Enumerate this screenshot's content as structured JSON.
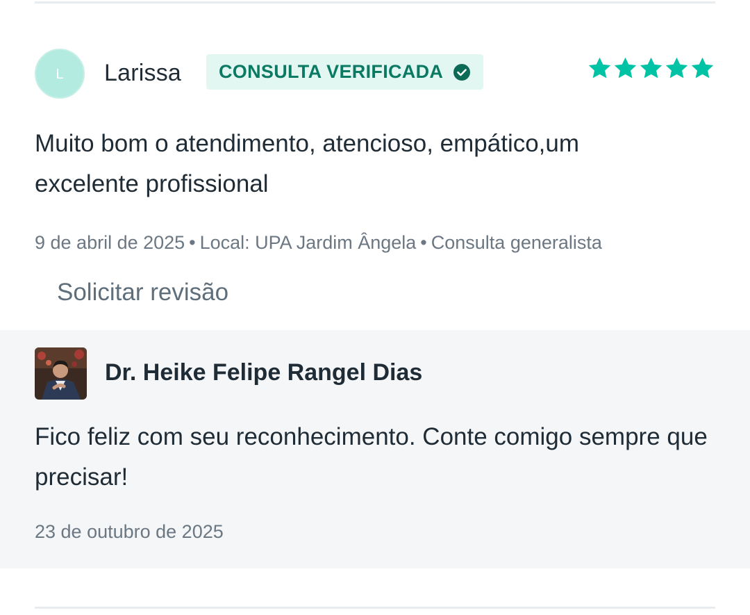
{
  "review": {
    "avatar_initial": "L",
    "reviewer_name": "Larissa",
    "verified_label": "CONSULTA VERIFICADA",
    "rating_stars": 5,
    "text": "Muito bom o atendimento, atencioso, empático,um excelente profissional",
    "date": "9 de abril de 2025",
    "separator": "•",
    "location": "Local: UPA Jardim Ângela",
    "service": "Consulta generalista",
    "request_review_label": "Solicitar revisão"
  },
  "reply": {
    "doctor_name": "Dr. Heike Felipe Rangel Dias",
    "text": "Fico feliz com seu reconhecimento. Conte comigo sempre que precisar!",
    "date": "23 de outubro de 2025"
  },
  "colors": {
    "accent": "#00c3a5",
    "badge_bg": "#e3f7f2",
    "badge_text": "#0b7a63",
    "reply_bg": "#f4f6f8"
  },
  "icons": {
    "verified": "check-circle-icon",
    "rating": "star-icon"
  }
}
